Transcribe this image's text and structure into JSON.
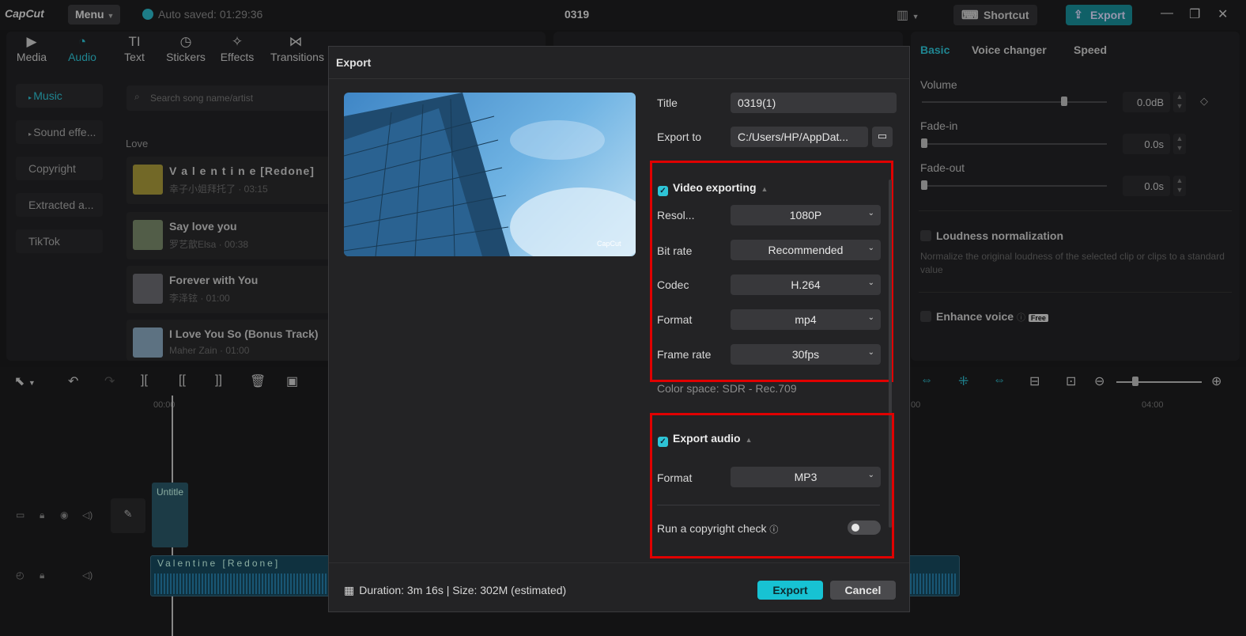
{
  "app": {
    "logo": "CapCut",
    "menu_label": "Menu",
    "autosave": "Auto saved: 01:29:36",
    "project_title": "0319",
    "shortcut_label": "Shortcut",
    "export_label": "Export"
  },
  "tools": [
    {
      "label": "Media",
      "icon": "media-icon"
    },
    {
      "label": "Audio",
      "icon": "audio-icon"
    },
    {
      "label": "Text",
      "icon": "text-icon"
    },
    {
      "label": "Stickers",
      "icon": "stickers-icon"
    },
    {
      "label": "Effects",
      "icon": "effects-icon"
    },
    {
      "label": "Transitions",
      "icon": "transitions-icon"
    }
  ],
  "audio_sidebar": [
    "Music",
    "Sound effe...",
    "Copyright",
    "Extracted a...",
    "TikTok"
  ],
  "search_placeholder": "Search song name/artist",
  "section_label": "Love",
  "songs": [
    {
      "name": "V a l e n t i n e [Redone]",
      "meta": "幸子小姐拜托了 · 03:15"
    },
    {
      "name": "Say love you",
      "meta": "罗艺歆Elsa · 00:38"
    },
    {
      "name": "Forever with You",
      "meta": "李泽铉 · 01:00"
    },
    {
      "name": "I Love You So (Bonus Track)",
      "meta": "Maher Zain · 01:00"
    }
  ],
  "right_panel": {
    "tabs": [
      "Basic",
      "Voice changer",
      "Speed"
    ],
    "volume_label": "Volume",
    "volume_value": "0.0dB",
    "volume_level": 0.75,
    "fadein_label": "Fade-in",
    "fadein_value": "0.0s",
    "fadeout_label": "Fade-out",
    "fadeout_value": "0.0s",
    "loudness_label": "Loudness normalization",
    "loudness_desc": "Normalize the original loudness of the selected clip or clips to a standard value",
    "enhance_label": "Enhance voice",
    "free_badge": "Free"
  },
  "timeline": {
    "ruler_start": "00:00",
    "ruler_end": "04:00",
    "ruler_mid": "00",
    "video_clip_label": "Untitle",
    "audio_clip_label": "Valentine [Redone]"
  },
  "dialog": {
    "title": "Export",
    "title_label": "Title",
    "title_value": "0319(1)",
    "export_to_label": "Export to",
    "export_to_value": "C:/Users/HP/AppDat...",
    "video_section": "Video exporting",
    "video_settings": [
      {
        "label": "Resol...",
        "value": "1080P"
      },
      {
        "label": "Bit rate",
        "value": "Recommended"
      },
      {
        "label": "Codec",
        "value": "H.264"
      },
      {
        "label": "Format",
        "value": "mp4"
      },
      {
        "label": "Frame rate",
        "value": "30fps"
      }
    ],
    "color_space": "Color space: SDR - Rec.709",
    "audio_section": "Export audio",
    "audio_format_label": "Format",
    "audio_format_value": "MP3",
    "copyright_label": "Run a copyright check",
    "copyright_enabled": false,
    "footer_info": "Duration: 3m 16s | Size: 302M (estimated)",
    "export_button": "Export",
    "cancel_button": "Cancel",
    "watermark": "CapCut"
  },
  "colors": {
    "accent": "#2ec4d6",
    "highlight_box": "#e00000"
  }
}
